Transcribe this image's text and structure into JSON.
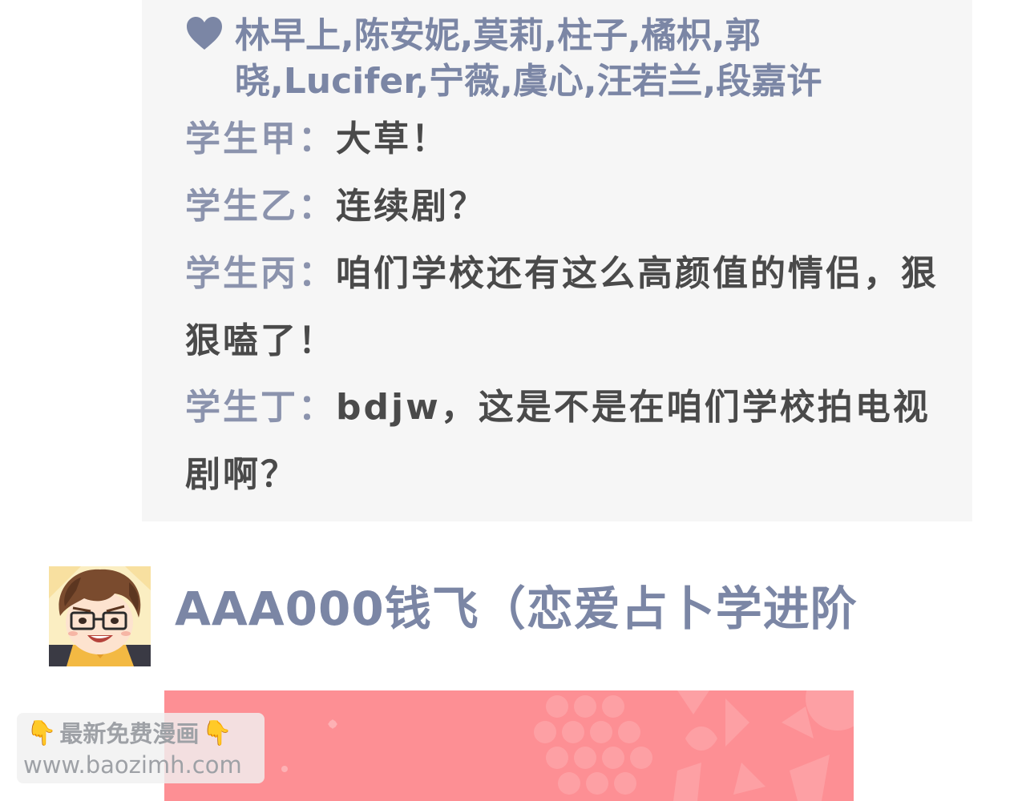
{
  "likes": {
    "icon": "heart-icon",
    "names": "林早上,陈安妮,莫莉,柱子,橘枳,郭晓,Lucifer,宁薇,虞心,汪若兰,段嘉许"
  },
  "comments": [
    {
      "speaker": "学生甲：",
      "text": "大草！"
    },
    {
      "speaker": "学生乙：",
      "text": "连续剧？"
    },
    {
      "speaker": "学生丙：",
      "text": "咱们学校还有这么高颜值的情侣，狠狠嗑了！"
    },
    {
      "speaker": "学生丁：",
      "text": "bdjw，这是不是在咱们学校拍电视剧啊？"
    }
  ],
  "author": {
    "name": "AAA000钱飞（恋爱占卜学进阶"
  },
  "watermark": {
    "icon": "pointing-down-hand-icon",
    "title": "最新免费漫画",
    "url": "www.baozimh.com"
  },
  "colors": {
    "panel": "#f6f6f6",
    "accent": "#7b86a5",
    "speaker": "#8b93ad",
    "text": "#4a4a4a",
    "banner": "#fd8f94"
  }
}
